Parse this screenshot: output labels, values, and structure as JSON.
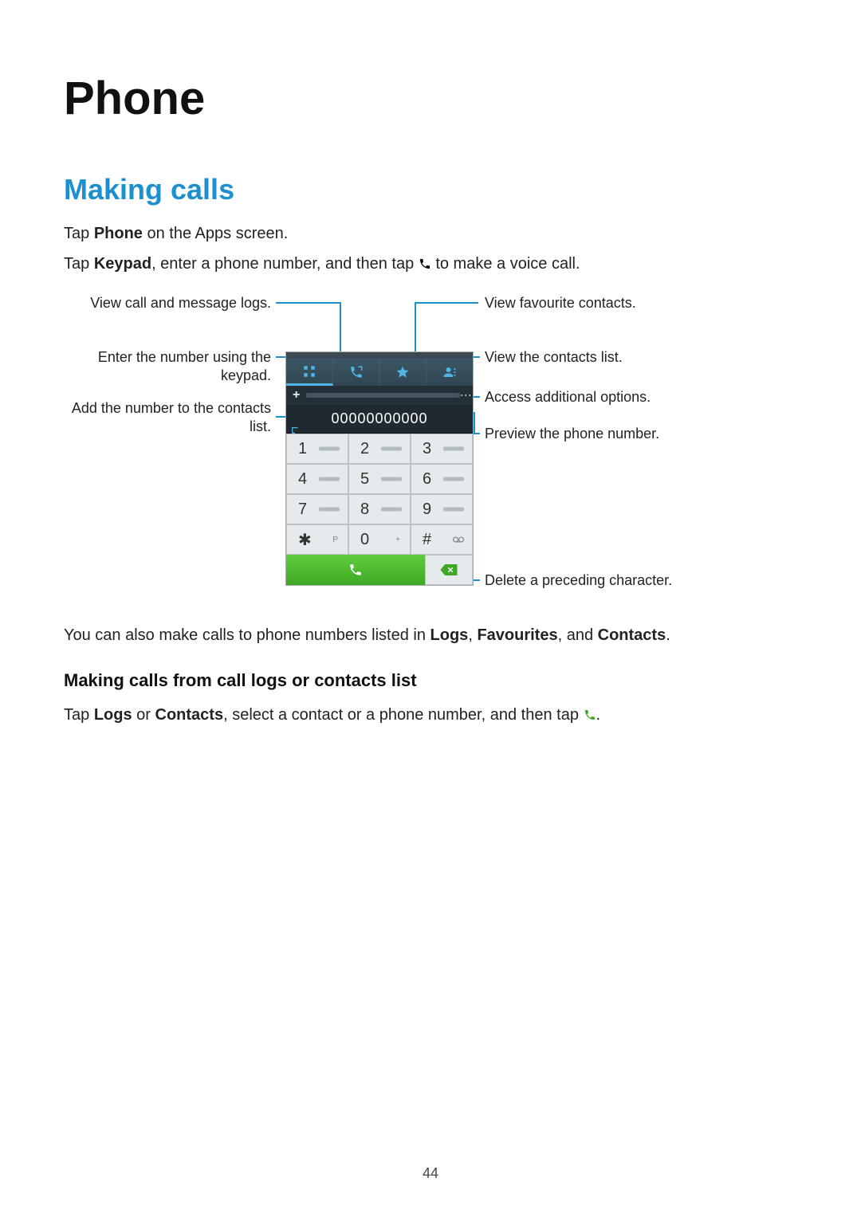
{
  "heading": "Phone",
  "section": "Making calls",
  "p1_pre": "Tap ",
  "p1_bold": "Phone",
  "p1_post": " on the Apps screen.",
  "p2_pre": "Tap ",
  "p2_bold": "Keypad",
  "p2_mid": ", enter a phone number, and then tap ",
  "p2_post": " to make a voice call.",
  "labels": {
    "logs": "View call and message logs.",
    "keypad_enter": "Enter the number using the keypad.",
    "add_contact": "Add the number to the contacts list.",
    "fav": "View favourite contacts.",
    "contacts_list": "View the contacts list.",
    "more_opts": "Access additional options.",
    "preview": "Preview the phone number.",
    "delete": "Delete a preceding character."
  },
  "phone_number_display": "00000000000",
  "keys": {
    "1": "1",
    "2": "2",
    "3": "3",
    "4": "4",
    "5": "5",
    "6": "6",
    "7": "7",
    "8": "8",
    "9": "9",
    "star": "✱",
    "star_sub": "P",
    "0": "0",
    "0_sub": "+",
    "hash": "#"
  },
  "p3_pre": "You can also make calls to phone numbers listed in ",
  "p3_b1": "Logs",
  "p3_s1": ", ",
  "p3_b2": "Favourites",
  "p3_s2": ", and ",
  "p3_b3": "Contacts",
  "p3_post": ".",
  "subsection": "Making calls from call logs or contacts list",
  "p4_pre": "Tap ",
  "p4_b1": "Logs",
  "p4_s1": " or ",
  "p4_b2": "Contacts",
  "p4_mid": ", select a contact or a phone number, and then tap ",
  "p4_post": ".",
  "page_number": "44"
}
